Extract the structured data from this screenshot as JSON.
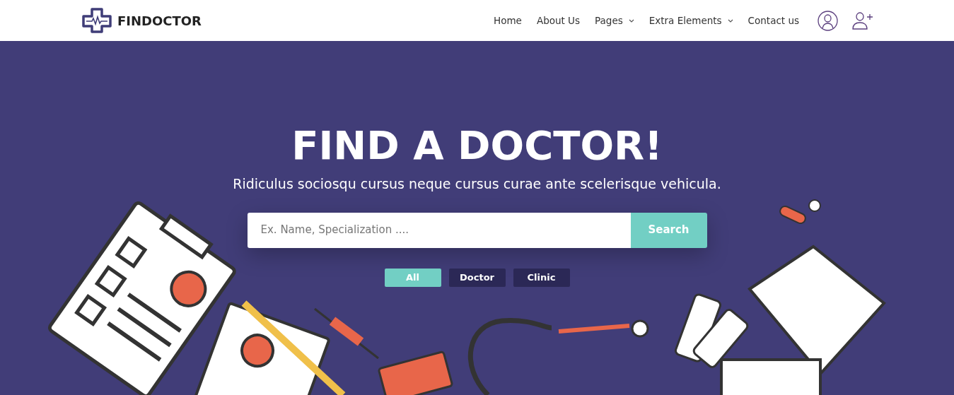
{
  "brand": {
    "name": "FINDOCTOR"
  },
  "nav": [
    {
      "label": "Home",
      "dropdown": false
    },
    {
      "label": "About Us",
      "dropdown": false
    },
    {
      "label": "Pages",
      "dropdown": true
    },
    {
      "label": "Extra Elements",
      "dropdown": true
    },
    {
      "label": "Contact us",
      "dropdown": false
    }
  ],
  "hero": {
    "title": "FIND A DOCTOR!",
    "subtitle": "Ridiculus sociosqu cursus neque cursus curae ante scelerisque vehicula."
  },
  "search": {
    "placeholder": "Ex. Name, Specialization ....",
    "button": "Search"
  },
  "filters": [
    {
      "label": "All",
      "selected": true
    },
    {
      "label": "Doctor",
      "selected": false
    },
    {
      "label": "Clinic",
      "selected": false
    }
  ]
}
